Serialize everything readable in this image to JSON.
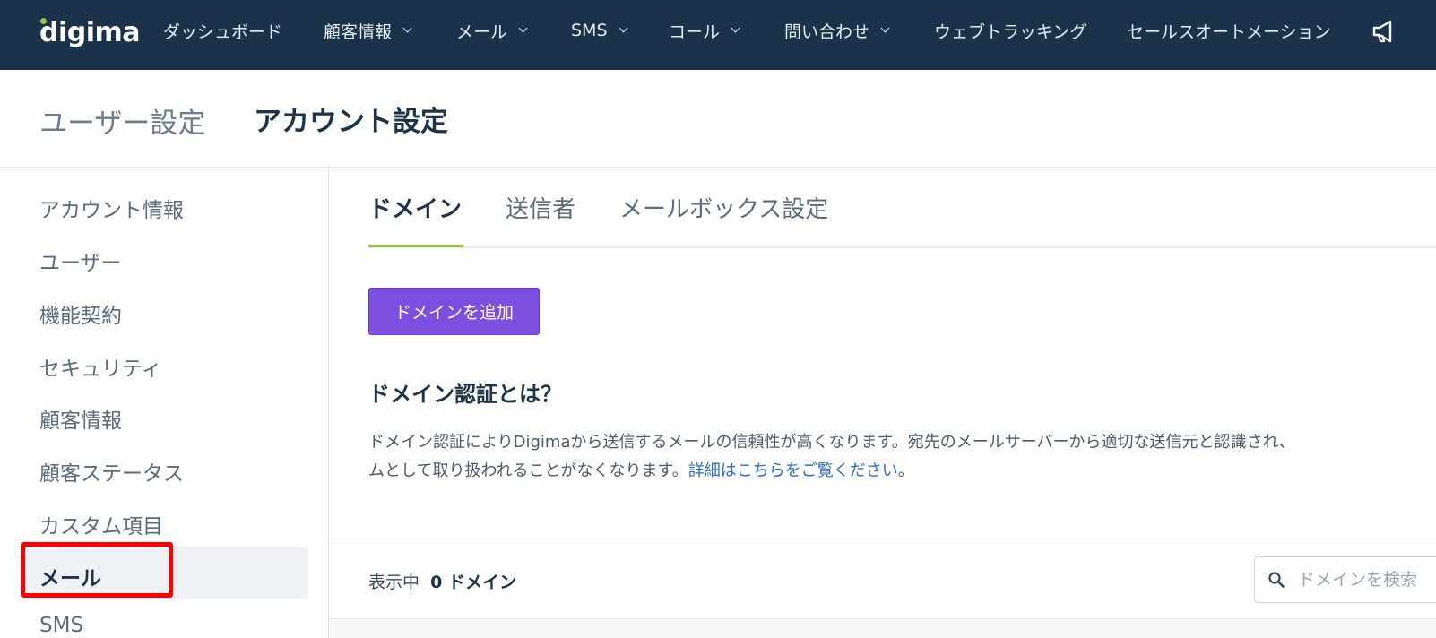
{
  "nav": {
    "logo": "digima",
    "items": [
      {
        "label": "ダッシュボード",
        "dropdown": false
      },
      {
        "label": "顧客情報",
        "dropdown": true
      },
      {
        "label": "メール",
        "dropdown": true
      },
      {
        "label": "SMS",
        "dropdown": true
      },
      {
        "label": "コール",
        "dropdown": true
      },
      {
        "label": "問い合わせ",
        "dropdown": true
      },
      {
        "label": "ウェブトラッキング",
        "dropdown": false
      },
      {
        "label": "セールスオートメーション",
        "dropdown": false
      }
    ]
  },
  "header": {
    "breadcrumb": "ユーザー設定",
    "title": "アカウント設定"
  },
  "sidebar": {
    "items": [
      {
        "label": "アカウント情報"
      },
      {
        "label": "ユーザー"
      },
      {
        "label": "機能契約"
      },
      {
        "label": "セキュリティ"
      },
      {
        "label": "顧客情報"
      },
      {
        "label": "顧客ステータス"
      },
      {
        "label": "カスタム項目"
      },
      {
        "label": "メール",
        "active": true
      },
      {
        "label": "SMS"
      }
    ]
  },
  "tabs": [
    {
      "label": "ドメイン",
      "active": true
    },
    {
      "label": "送信者"
    },
    {
      "label": "メールボックス設定"
    }
  ],
  "main": {
    "add_button": "ドメインを追加",
    "section_title": "ドメイン認証とは？",
    "description_line1": "ドメイン認証によりDigimaから送信するメールの信頼性が高くなります。宛先のメールサーバーから適切な送信元と認識され、",
    "description_line2_prefix": "ムとして取り扱われることがなくなります。",
    "description_link": "詳細はこちらをご覧ください",
    "description_suffix": "。",
    "count_prefix": "表示中",
    "count_value": "0 ドメイン",
    "search_placeholder": "ドメインを検索"
  },
  "colors": {
    "nav_bg": "#1b334a",
    "accent_green": "#8ec63f",
    "button_purple": "#7c4fe0",
    "link_blue": "#2a6fc9",
    "highlight_red": "#ff0000"
  }
}
